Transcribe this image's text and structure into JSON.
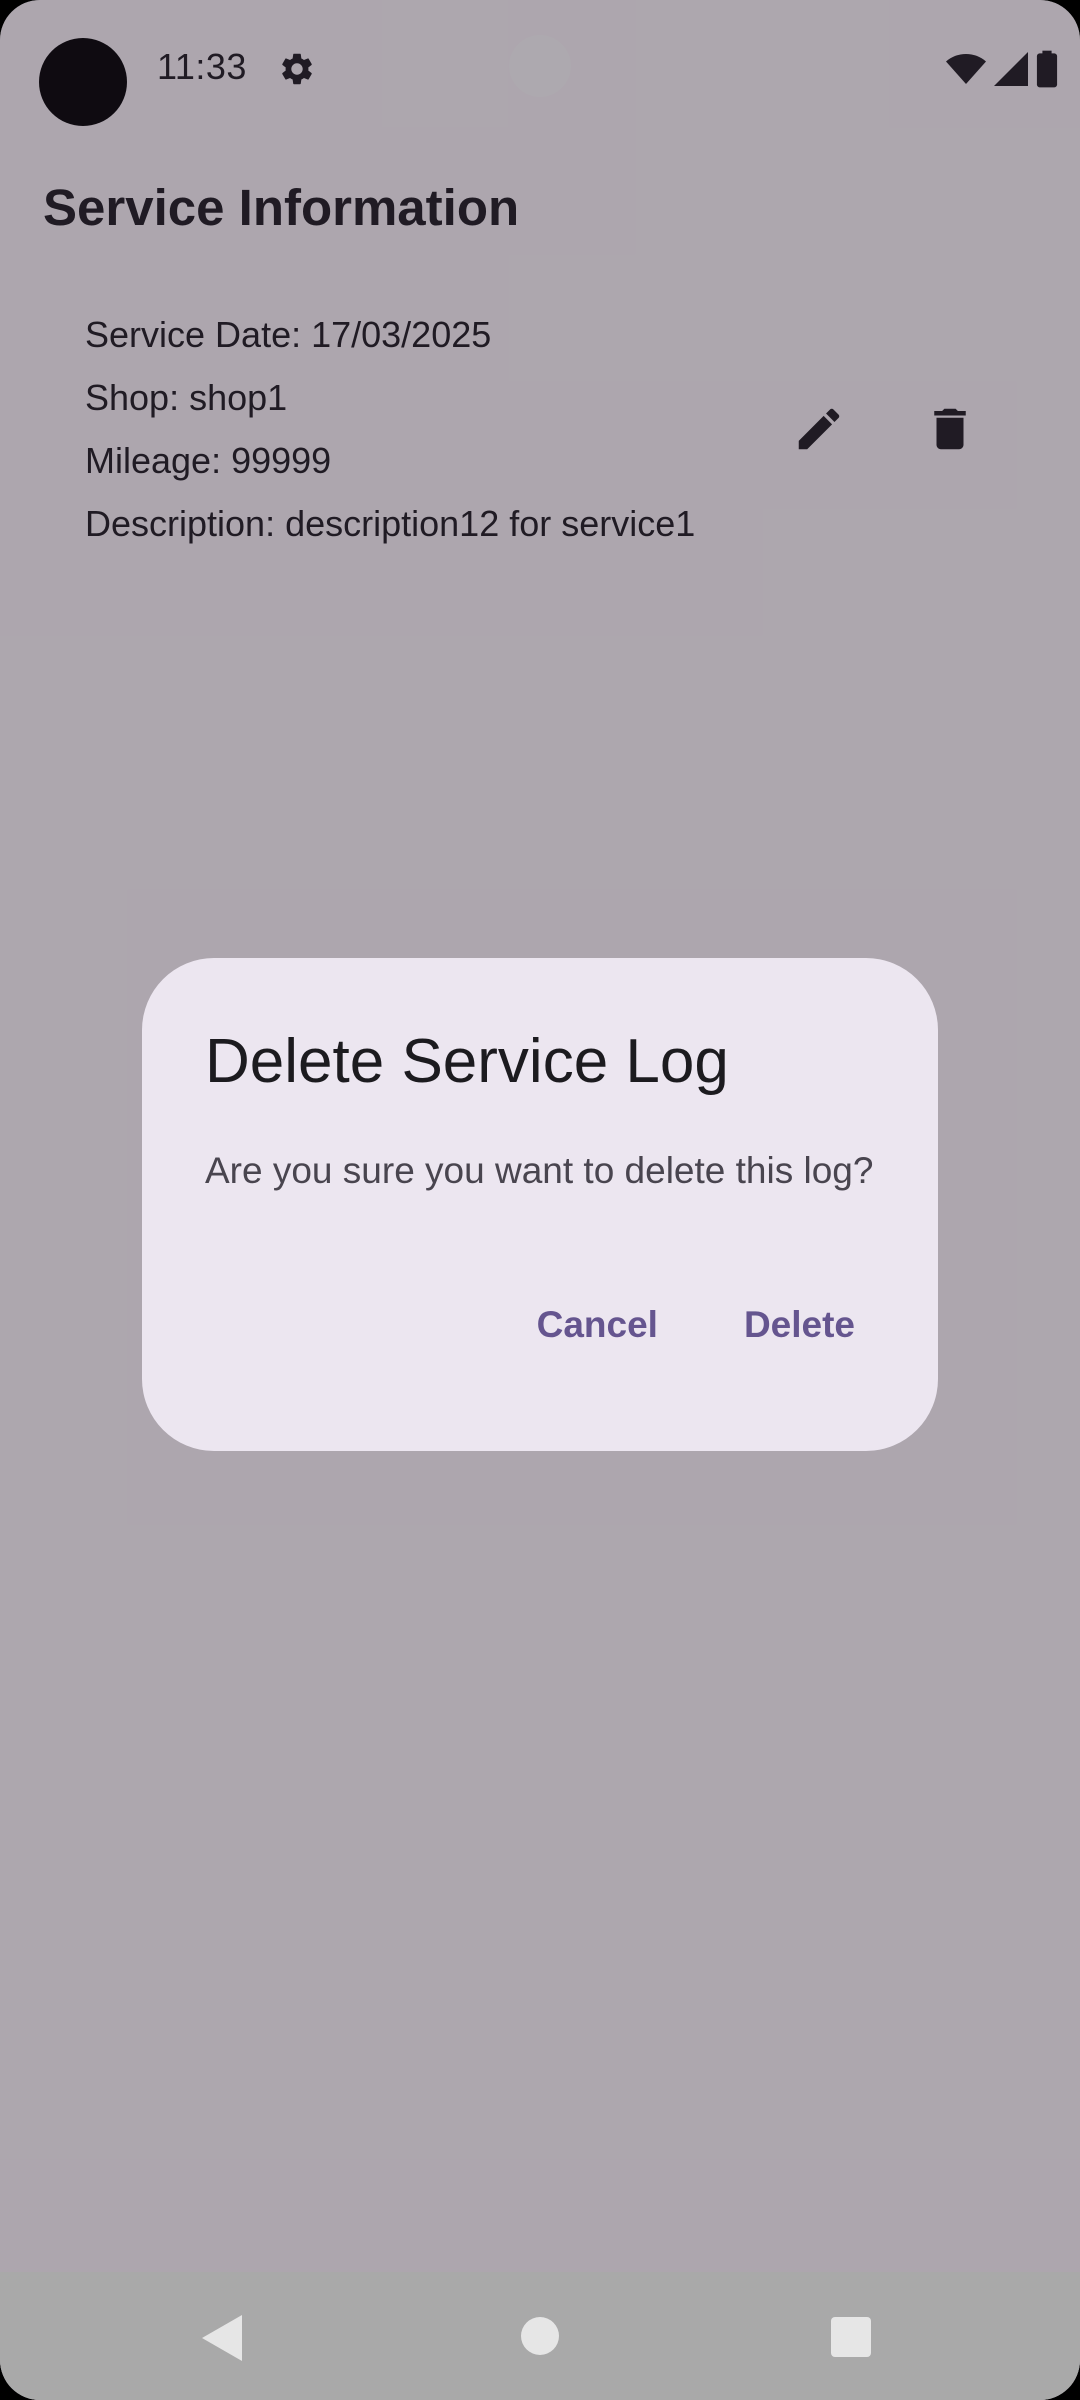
{
  "status_bar": {
    "time": "11:33",
    "icons": [
      "settings-icon",
      "wifi-icon",
      "cell-signal-icon",
      "battery-icon"
    ]
  },
  "page": {
    "title": "Service Information"
  },
  "service_log": {
    "date_line": "Service Date: 17/03/2025",
    "shop_line": "Shop: shop1",
    "mileage_line": "Mileage: 99999",
    "description_line": "Description: description12 for service1",
    "actions": [
      "edit-icon",
      "delete-icon"
    ]
  },
  "dialog": {
    "title": "Delete Service Log",
    "message": "Are you sure you want to delete this log?",
    "cancel_label": "Cancel",
    "confirm_label": "Delete"
  },
  "nav_bar": {
    "buttons": [
      "back-icon",
      "home-icon",
      "recents-icon"
    ]
  },
  "colors": {
    "background": "#FFFBFE",
    "dialog_surface": "#ECE6F0",
    "accent": "#65558F",
    "text": "#1C1B1F"
  }
}
